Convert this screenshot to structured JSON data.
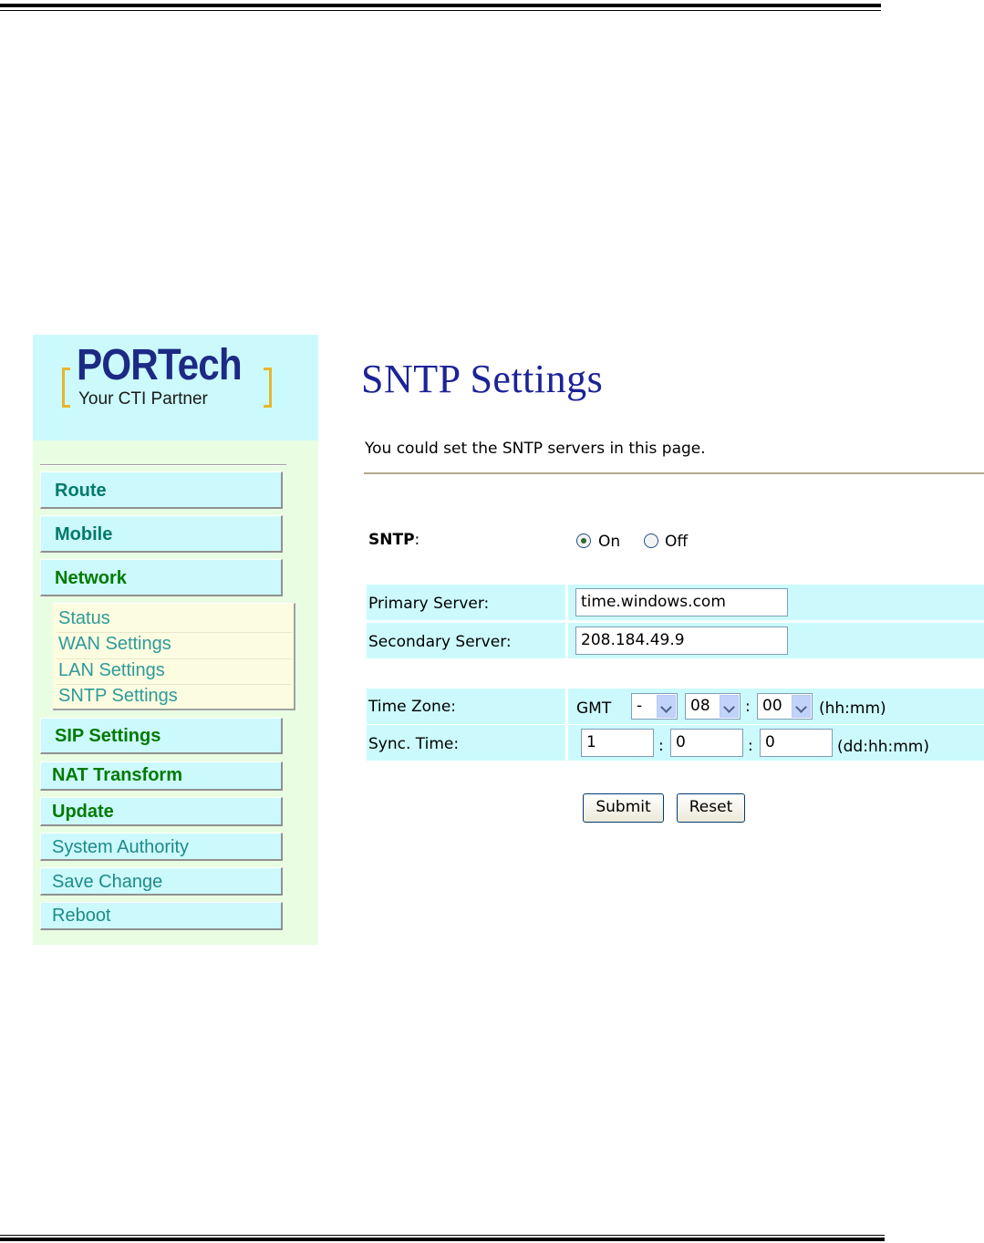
{
  "logo": {
    "brand": "PORTech",
    "tagline": "Your CTI Partner"
  },
  "sidebar": {
    "menu": [
      {
        "label": "Route"
      },
      {
        "label": "Mobile"
      },
      {
        "label": "Network"
      },
      {
        "label": "SIP Settings"
      },
      {
        "label": "NAT Transform"
      },
      {
        "label": "Update"
      },
      {
        "label": "System Authority"
      },
      {
        "label": "Save Change"
      },
      {
        "label": "Reboot"
      }
    ],
    "network_submenu": [
      {
        "label": "Status"
      },
      {
        "label": "WAN Settings"
      },
      {
        "label": "LAN Settings"
      },
      {
        "label": "SNTP Settings"
      }
    ]
  },
  "page": {
    "title": "SNTP Settings",
    "intro": "You could set the SNTP servers in this page."
  },
  "form": {
    "sntp_label": "SNTP",
    "sntp_colon": ":",
    "on_label": "On",
    "off_label": "Off",
    "sntp_selected": "On",
    "primary_label": "Primary Server:",
    "primary_value": "time.windows.com",
    "secondary_label": "Secondary Server:",
    "secondary_value": "208.184.49.9",
    "timezone_label": "Time Zone:",
    "gmt_label": "GMT",
    "tz_sign": "-",
    "tz_hours": "08",
    "tz_minutes": "00",
    "tz_colon": ":",
    "tz_unit": "(hh:mm)",
    "sync_label": "Sync. Time:",
    "sync_days": "1",
    "sync_hours": "0",
    "sync_minutes": "0",
    "sync_colon": ":",
    "sync_unit": "(dd:hh:mm)",
    "submit_label": "Submit",
    "reset_label": "Reset"
  },
  "colors": {
    "title": "#1c2396",
    "sidebar_bg": "#e9fde3",
    "menu_bg": "#ccfafc",
    "row_bg": "#ccfafc",
    "submenu_bg": "#fbfce0"
  }
}
